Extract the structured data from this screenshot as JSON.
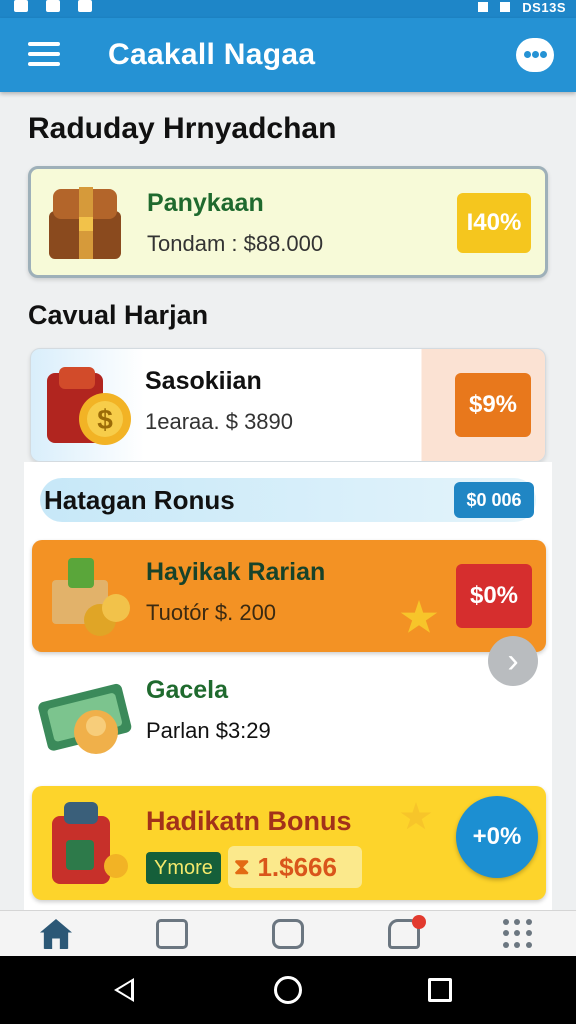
{
  "status": {
    "time": "DS13S"
  },
  "app": {
    "title": "Caakall Nagaa"
  },
  "section1": {
    "title": "Raduday Hrnyadchan"
  },
  "featured": {
    "name": "Panykaan",
    "detail": "Tondam : $88.000",
    "badge": "I40%"
  },
  "section2": {
    "title": "Cavual Harjan"
  },
  "items": [
    {
      "name": "Sasokiian",
      "detail": "1earaa. $ 3890",
      "badge": "$9%"
    },
    {
      "name": "Hayikak Rarian",
      "detail": "Tuotór $. 200",
      "badge": "$0%"
    },
    {
      "name": "Gacela",
      "detail": "Parlan $3:29"
    },
    {
      "name": "Hadikatn Bonus",
      "more": "Ymore",
      "amount": "1.$666",
      "badge": "+0%"
    }
  ],
  "bonus": {
    "label": "Hatagan Ronus",
    "value": "$0 006"
  },
  "nav": [
    "home-icon",
    "inbox-icon",
    "camera-icon",
    "wallet-icon",
    "apps-grid-icon"
  ],
  "colors": {
    "primary": "#2592d4",
    "orange": "#f39224",
    "yellow": "#fdd42b",
    "red": "#d62e2e",
    "green": "#155f3a"
  }
}
